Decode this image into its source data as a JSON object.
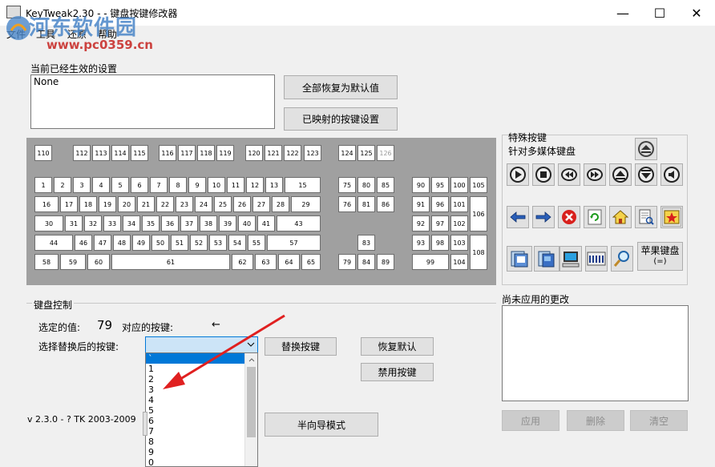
{
  "window": {
    "title": "KeyTweak2.30 - - 键盘按键修改器"
  },
  "menu": [
    "文件",
    "工具",
    "还原",
    "帮助"
  ],
  "watermark": {
    "text": "河东软件园",
    "url": "www.pc0359.cn"
  },
  "current_settings": {
    "label": "当前已经生效的设置",
    "value": "None"
  },
  "buttons": {
    "restore_all": "全部恢复为默认值",
    "mapped_keys": "已映射的按键设置",
    "replace_key": "替换按键",
    "restore_default": "恢复默认",
    "disable_key": "禁用按键",
    "half_wizard": "半向导模式",
    "apply": "应用",
    "delete": "删除",
    "clear": "清空"
  },
  "special": {
    "title": "特殊按键",
    "subtitle": "针对多媒体键盘",
    "apple_label": "苹果键盘",
    "apple_sub": "(=)"
  },
  "keyboard_control": {
    "label": "键盘控制",
    "selected_value_label": "选定的值:",
    "selected_value": "79",
    "mapped_key_label": "对应的按键:",
    "mapped_key_value": "←",
    "replace_label": "选择替换后的按键:",
    "dropdown_value": ""
  },
  "pending": {
    "label": "尚未应用的更改"
  },
  "version": "v 2.3.0 - ? TK 2003-2009",
  "dropdown_items": [
    "`",
    "1",
    "2",
    "3",
    "4",
    "5",
    "6",
    "7",
    "8",
    "9",
    "0"
  ],
  "keys": {
    "fn_row": [
      "110",
      "112",
      "113",
      "114",
      "115",
      "116",
      "117",
      "118",
      "119",
      "120",
      "121",
      "122",
      "123",
      "124",
      "125",
      "126"
    ],
    "row1": [
      "1",
      "2",
      "3",
      "4",
      "5",
      "6",
      "7",
      "8",
      "9",
      "10",
      "11",
      "12",
      "13",
      "15"
    ],
    "row2": [
      "16",
      "17",
      "18",
      "19",
      "20",
      "21",
      "22",
      "23",
      "24",
      "25",
      "26",
      "27",
      "28",
      "29"
    ],
    "row3": [
      "30",
      "31",
      "32",
      "33",
      "34",
      "35",
      "36",
      "37",
      "38",
      "39",
      "40",
      "41",
      "43"
    ],
    "row4": [
      "44",
      "46",
      "47",
      "48",
      "49",
      "50",
      "51",
      "52",
      "53",
      "54",
      "55",
      "57"
    ],
    "row5": [
      "58",
      "59",
      "60",
      "61",
      "62",
      "63",
      "64",
      "65"
    ],
    "nav": [
      "75",
      "80",
      "85",
      "76",
      "81",
      "86",
      "83",
      "79",
      "84",
      "89"
    ],
    "numpad": [
      "90",
      "95",
      "100",
      "105",
      "91",
      "96",
      "101",
      "106",
      "92",
      "97",
      "102",
      "93",
      "98",
      "103",
      "108",
      "99",
      "104"
    ]
  }
}
